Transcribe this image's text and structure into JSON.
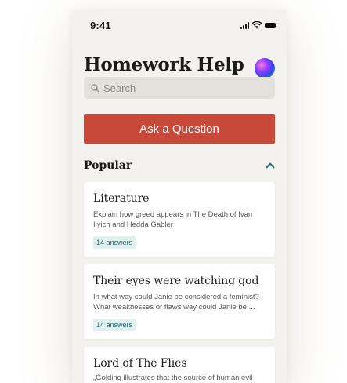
{
  "status_bar": {
    "time": "9:41"
  },
  "header": {
    "title": "Homework Help"
  },
  "search": {
    "placeholder": "Search"
  },
  "actions": {
    "ask_label": "Ask a Question"
  },
  "section": {
    "title": "Popular"
  },
  "cards": [
    {
      "title": "Literature",
      "body": "Explain how greed appears in The Death of Ivan Ilyich and Hedda Gabler",
      "answers": "14 answers"
    },
    {
      "title": "Their eyes were watching god",
      "body": "In what way could Janie be considered a feminist? What weaknesses or flaws way could Janie be ...",
      "answers": "14 answers"
    },
    {
      "title": "Lord of The Flies",
      "body": "„Golding illustrates that the source of human evil"
    }
  ],
  "colors": {
    "accent": "#c8483a",
    "background": "#f4f2ee",
    "badge_bg": "#dff0ee",
    "badge_text": "#1f6a72"
  }
}
